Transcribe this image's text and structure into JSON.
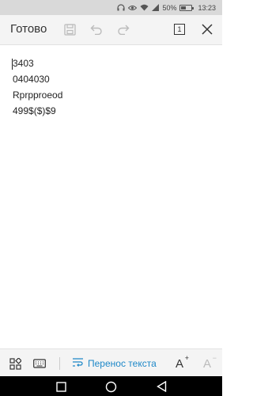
{
  "status_bar": {
    "battery_percent": "50%",
    "time": "13:23",
    "icons": [
      "headphones-icon",
      "eye-icon",
      "wifi-icon",
      "signal-icon",
      "battery-icon"
    ]
  },
  "toolbar": {
    "done_label": "Готово",
    "page_count": "1",
    "icons": [
      "save-icon",
      "undo-icon",
      "redo-icon",
      "page-count-icon",
      "close-icon"
    ]
  },
  "document": {
    "lines": [
      "3403",
      "0404030",
      "Rprpproeod",
      "499$($)$9"
    ]
  },
  "bottom_toolbar": {
    "wrap_label": "Перенос текста",
    "font_increase": "A",
    "font_decrease": "A",
    "accent_color": "#1e88c8"
  }
}
